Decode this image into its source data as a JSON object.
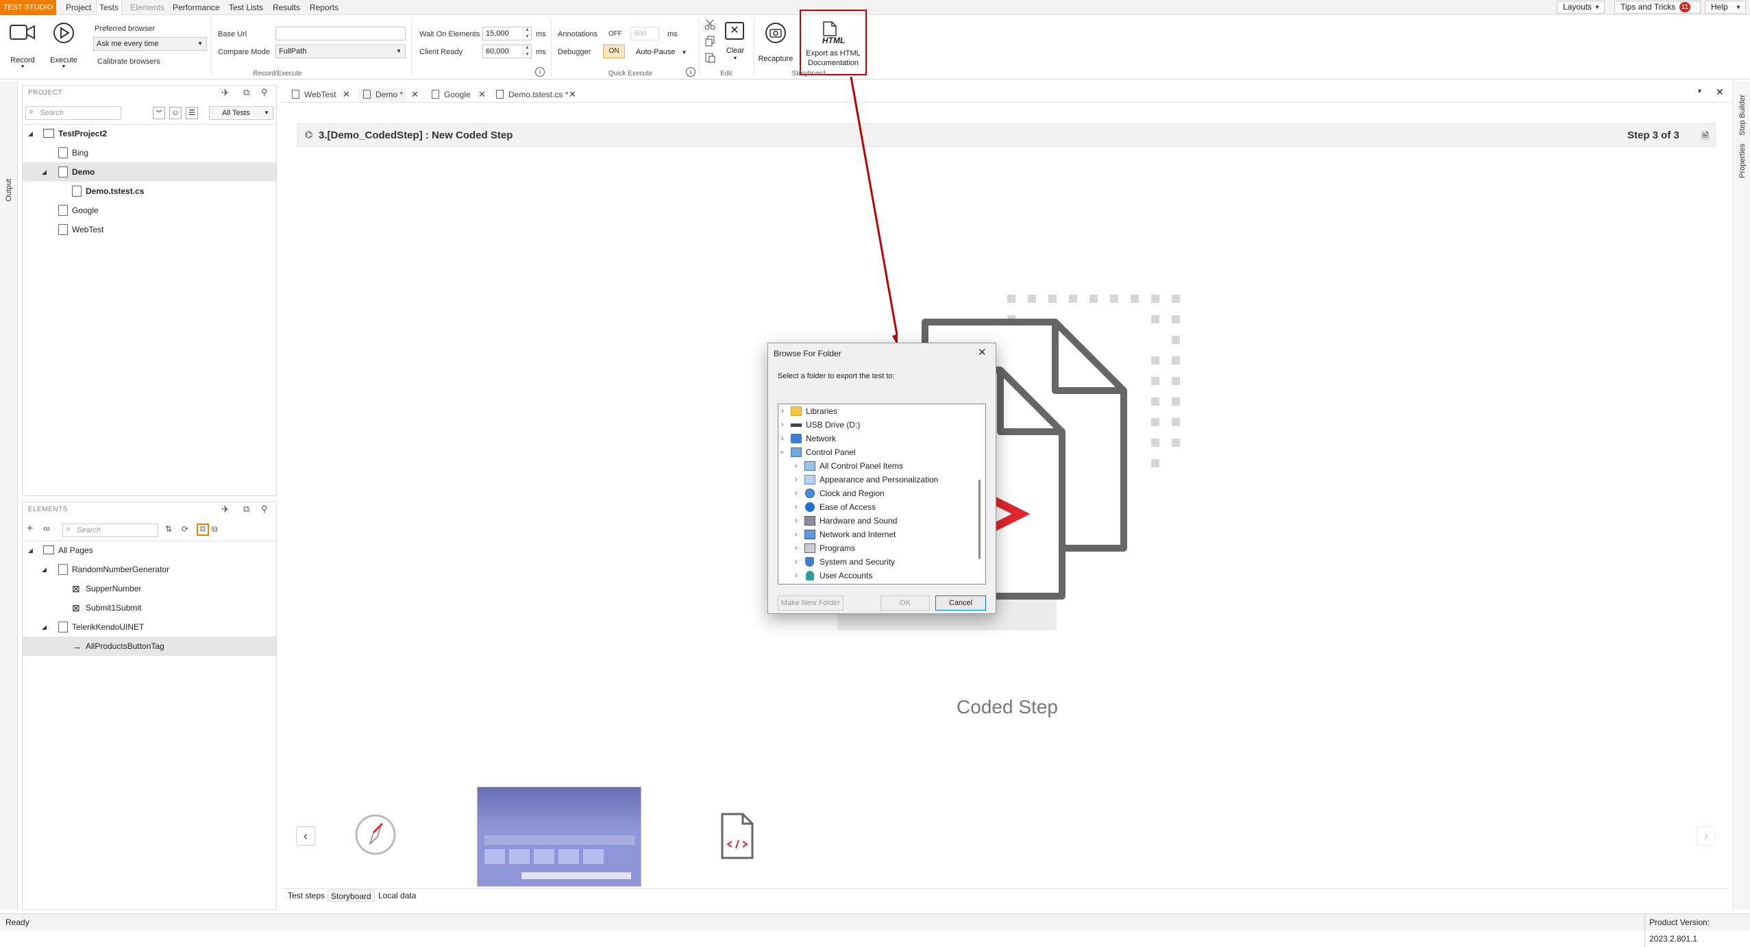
{
  "menubar": {
    "brand": "TEST STUDIO",
    "items": [
      "Project",
      "Tests",
      "Elements",
      "Performance",
      "Test Lists",
      "Results",
      "Reports"
    ],
    "layouts": "Layouts",
    "tips": "Tips and Tricks",
    "tips_badge": "11",
    "help": "Help"
  },
  "ribbon": {
    "record": "Record",
    "execute": "Execute",
    "preferred_browser_label": "Preferred browser",
    "preferred_browser_value": "Ask me every time",
    "calibrate": "Calibrate browsers",
    "base_url_label": "Base Url",
    "base_url_value": "",
    "compare_mode_label": "Compare Mode",
    "compare_mode_value": "FullPath",
    "group_record_execute": "Record/Execute",
    "wait_on_elements_label": "Wait On Elements",
    "wait_on_elements_value": "15,000",
    "client_ready_label": "Client Ready",
    "client_ready_value": "60,000",
    "ms": "ms",
    "annotations_label": "Annotations",
    "annotations_off": "OFF",
    "annotations_value": "400",
    "debugger_label": "Debugger",
    "debugger_on": "ON",
    "auto_pause": "Auto-Pause",
    "group_quick_execute": "Quick Execute",
    "clear": "Clear",
    "group_edit": "Edit",
    "recapture": "Recapture",
    "export_html_icon_text": "HTML",
    "export_html_line1": "Export as HTML",
    "export_html_line2": "Documentation",
    "group_storyboard": "Storyboard"
  },
  "project_panel": {
    "title": "PROJECT",
    "search_placeholder": "Search",
    "filter": "All Tests",
    "items": [
      {
        "label": "TestProject2",
        "bold": true
      },
      {
        "label": "Bing",
        "bold": false
      },
      {
        "label": "Demo",
        "bold": true
      },
      {
        "label": "Demo.tstest.cs",
        "bold": true
      },
      {
        "label": "Google",
        "bold": false
      },
      {
        "label": "WebTest",
        "bold": false
      }
    ]
  },
  "elements_panel": {
    "title": "ELEMENTS",
    "search_placeholder": "Search",
    "items": [
      "All Pages",
      "RandomNumberGenerator",
      "SupperNumber",
      "Submit1Submit",
      "TelerikKendoUINET",
      "AllProductsButtonTag"
    ]
  },
  "side_tabs": {
    "left": "Output",
    "right1": "Step Builder",
    "right2": "Properties"
  },
  "doc_tabs": [
    "WebTest",
    "Demo *",
    "Google",
    "Demo.tstest.cs *"
  ],
  "step_header": {
    "title": "3.[Demo_CodedStep] : New Coded Step",
    "step_of": "Step 3 of 3"
  },
  "canvas": {
    "caption": "Coded Step",
    "red_marks": "< >"
  },
  "dialog": {
    "title": "Browse For Folder",
    "prompt": "Select a folder to export the test to:",
    "folders": [
      {
        "label": "Libraries",
        "icon": "folder-icon",
        "level": 0
      },
      {
        "label": "USB Drive (D:)",
        "icon": "usb-drive-icon",
        "level": 0
      },
      {
        "label": "Network",
        "icon": "network-icon",
        "level": 0
      },
      {
        "label": "Control Panel",
        "icon": "control-panel-icon",
        "level": 0
      },
      {
        "label": "All Control Panel Items",
        "icon": "control-panel-icon",
        "level": 1
      },
      {
        "label": "Appearance and Personalization",
        "icon": "appearance-icon",
        "level": 1
      },
      {
        "label": "Clock and Region",
        "icon": "clock-icon",
        "level": 1
      },
      {
        "label": "Ease of Access",
        "icon": "ease-of-access-icon",
        "level": 1
      },
      {
        "label": "Hardware and Sound",
        "icon": "hardware-icon",
        "level": 1
      },
      {
        "label": "Network and Internet",
        "icon": "network-internet-icon",
        "level": 1
      },
      {
        "label": "Programs",
        "icon": "programs-icon",
        "level": 1
      },
      {
        "label": "System and Security",
        "icon": "shield-icon",
        "level": 1
      },
      {
        "label": "User Accounts",
        "icon": "user-icon",
        "level": 1
      }
    ],
    "make_new_folder": "Make New Folder",
    "ok": "OK",
    "cancel": "Cancel"
  },
  "bottom_tabs": [
    "Test steps",
    "Storyboard",
    "Local data"
  ],
  "status": {
    "text": "Ready",
    "version": "Product Version: 2023.2.801.1"
  },
  "colors": {
    "brand_orange": "#f07d00",
    "highlight_red": "#c00000",
    "badge_red": "#d9251d"
  }
}
